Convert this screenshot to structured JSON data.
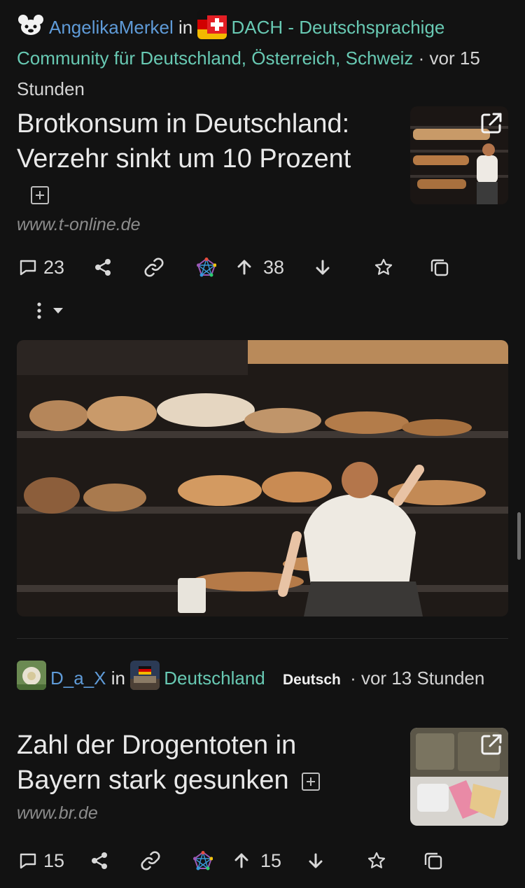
{
  "posts": [
    {
      "author": "AngelikaMerkel",
      "in_label": "in",
      "community": "DACH - Deutschsprachige Community für Deutschland, Österreich, Schweiz",
      "time": "· vor 15 Stunden",
      "title": "Brotkonsum in Deutschland: Verzehr sinkt um 10 Prozent",
      "domain": "www.t-online.de",
      "comments": "23",
      "score": "38"
    },
    {
      "author": "D_a_X",
      "in_label": "in",
      "community": "Deutschland",
      "language": "Deutsch",
      "time": "· vor 13 Stunden",
      "title": "Zahl der Drogentoten in Bayern stark gesunken",
      "domain": "www.br.de",
      "comments": "15",
      "score": "15"
    }
  ],
  "colors": {
    "background": "#121212",
    "user_link": "#5f9bd8",
    "community_link": "#68c9b3",
    "muted": "#8c8c8c"
  },
  "icons": [
    "comment-icon",
    "share-icon",
    "link-icon",
    "fediverse-icon",
    "upvote-icon",
    "downvote-icon",
    "star-icon",
    "copy-icon",
    "more-icon",
    "dropdown-icon",
    "external-link-icon",
    "expand-icon"
  ]
}
